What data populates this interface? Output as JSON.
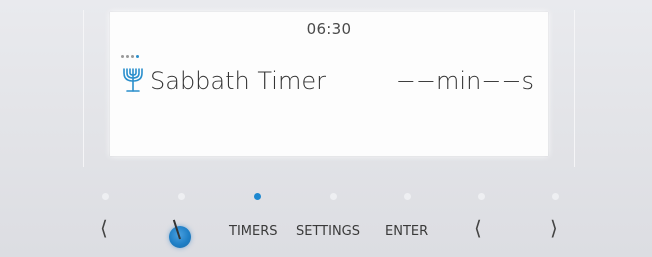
{
  "display": {
    "clock": "06:30",
    "title": "Sabbath Timer",
    "value": "−−min−−s",
    "icon": "menorah-icon",
    "page_dots": 4,
    "active_dot": 4
  },
  "controls": {
    "left_arrow_1": "⟨",
    "timers_label": "TIMERS",
    "settings_label": "SETTINGS",
    "enter_label": "ENTER",
    "left_arrow_2": "⟨",
    "right_arrow": "⟩"
  },
  "indicators": {
    "count": 7,
    "active_index": 2
  },
  "colors": {
    "accent": "#1e88d0",
    "display_bg": "#fdfdfd",
    "panel_bg": "#e4e5e9"
  }
}
